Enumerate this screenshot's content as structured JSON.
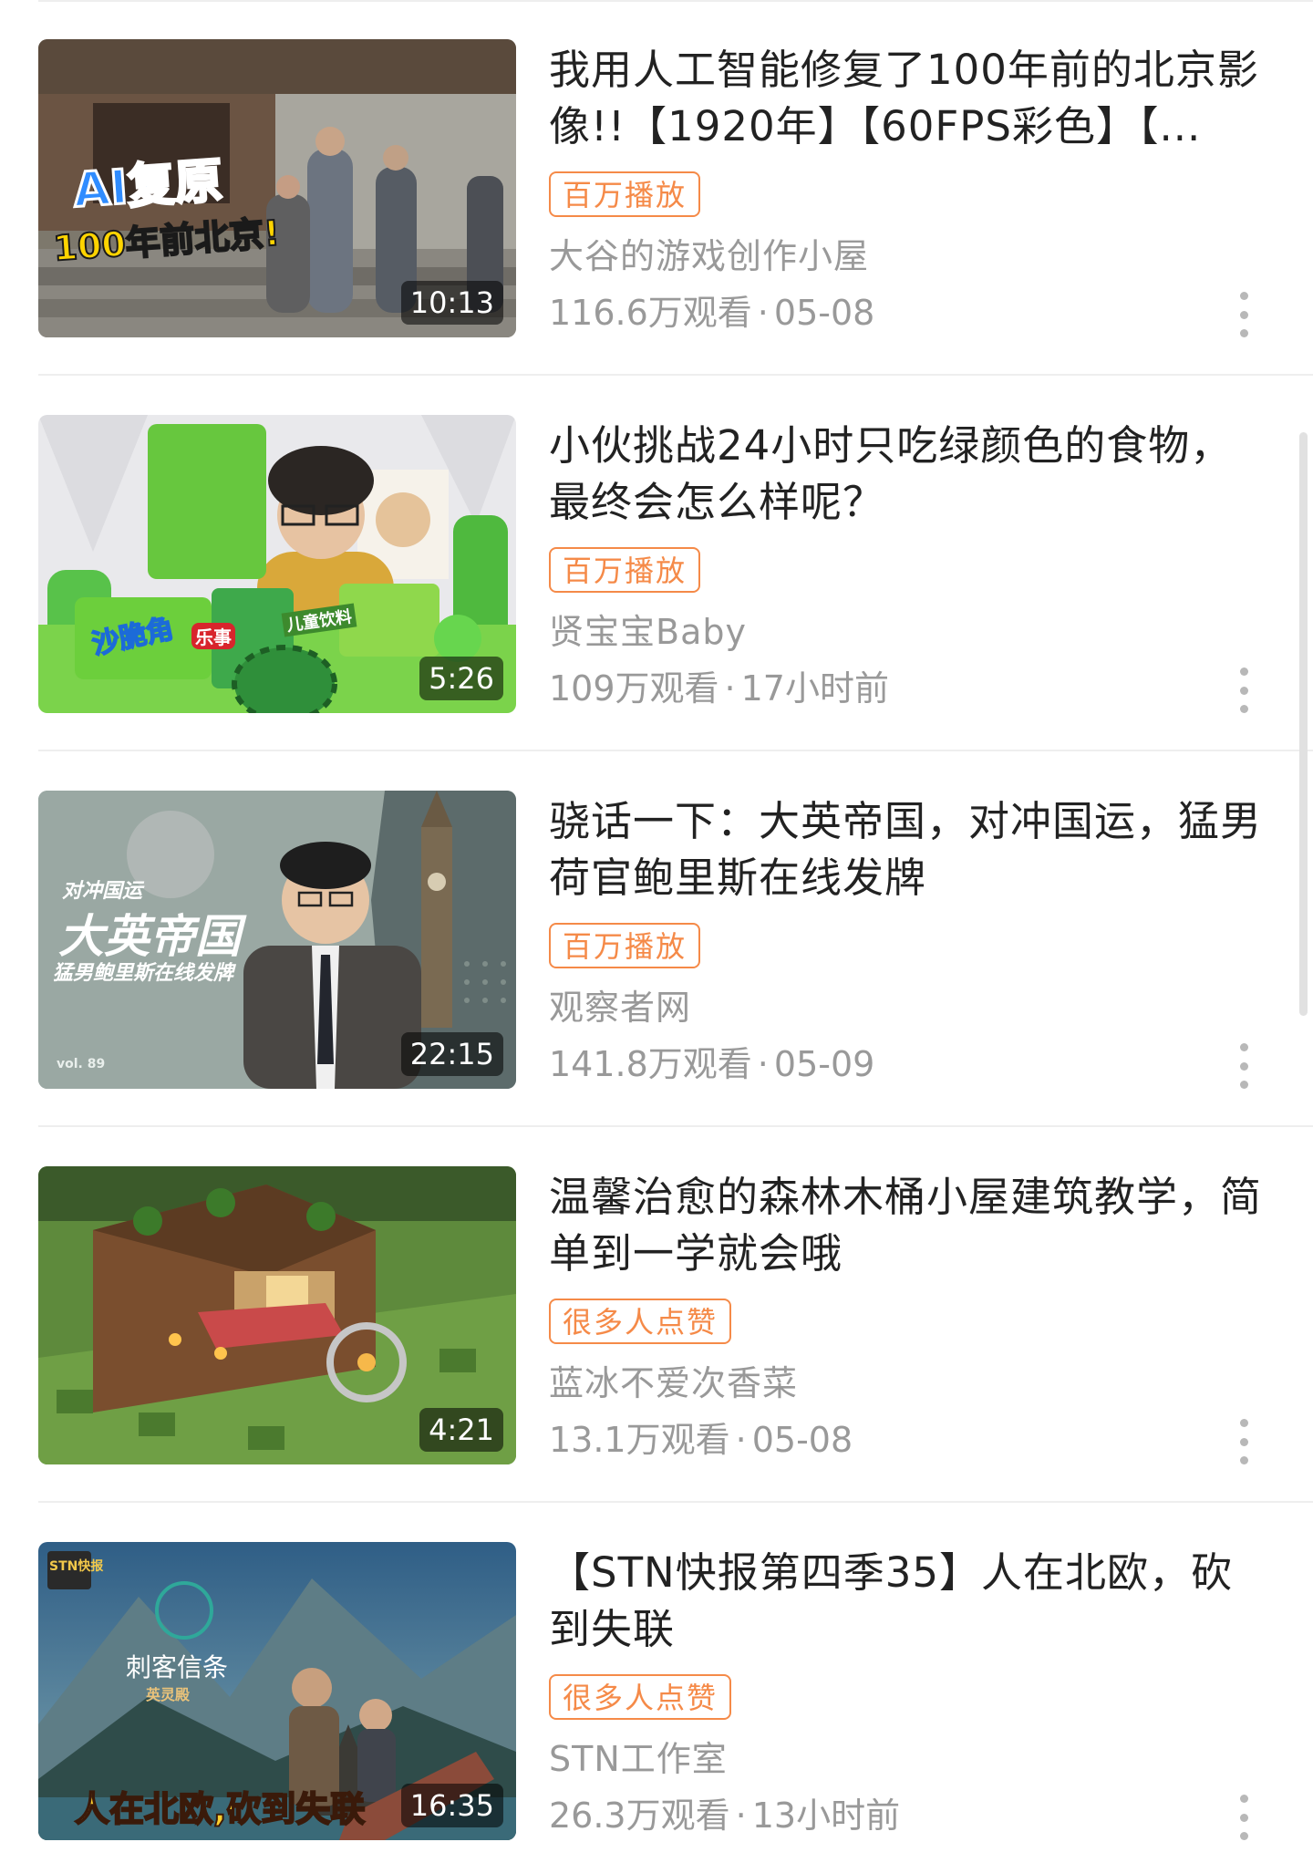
{
  "videos": [
    {
      "title": "我用人工智能修复了100年前的北京影像!!【1920年】【60FPS彩色】【...",
      "badge": "百万播放",
      "channel": "大谷的游戏创作小屋",
      "views": "116.6万观看",
      "date": "05-08",
      "duration": "10:13",
      "thumb_text": [
        "AI复原",
        "100年前北京!"
      ]
    },
    {
      "title": "小伙挑战24小时只吃绿颜色的食物，最终会怎么样呢？",
      "badge": "百万播放",
      "channel": "贤宝宝Baby",
      "views": "109万观看",
      "date": "17小时前",
      "duration": "5:26",
      "thumb_text": [
        "沙脆角",
        "乐事",
        "儿童饮料"
      ]
    },
    {
      "title": "骁话一下：大英帝国，对冲国运，猛男荷官鲍里斯在线发牌",
      "badge": "百万播放",
      "channel": "观察者网",
      "views": "141.8万观看",
      "date": "05-09",
      "duration": "22:15",
      "thumb_text": [
        "对冲国运",
        "大英帝国",
        "猛男鲍里斯在线发牌",
        "vol. 89"
      ]
    },
    {
      "title": "温馨治愈的森林木桶小屋建筑教学，简单到一学就会哦",
      "badge": "很多人点赞",
      "channel": "蓝冰不爱次香菜",
      "views": "13.1万观看",
      "date": "05-08",
      "duration": "4:21",
      "thumb_text": []
    },
    {
      "title": "【STN快报第四季35】人在北欧，砍到失联",
      "badge": "很多人点赞",
      "channel": "STN工作室",
      "views": "26.3万观看",
      "date": "13小时前",
      "duration": "16:35",
      "thumb_text": [
        "STN快报",
        "刺客信条",
        "英灵殿",
        "人在北欧,砍到失联"
      ]
    }
  ],
  "meta_separator": "·",
  "colors": {
    "badge": "#f58a48",
    "title": "#222222",
    "secondary": "#999999",
    "divider": "#eeeeee"
  },
  "icons": {
    "more": "vertical-ellipsis"
  }
}
